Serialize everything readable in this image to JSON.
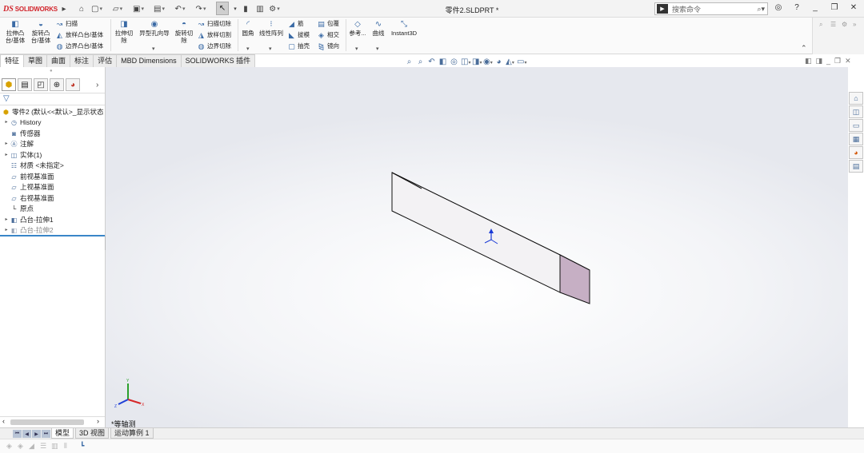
{
  "titlebar": {
    "logo_ds": "DS",
    "logo_text": "SOLIDWORKS",
    "document_title": "零件2.SLDPRT *",
    "search_placeholder": "搜索命令"
  },
  "ribbon": {
    "extrude_boss": "拉伸凸台/基体",
    "revolve_boss": "旋转凸台/基体",
    "sweep": "扫描",
    "loft_boss": "放样凸台/基体",
    "boundary_boss": "边界凸台/基体",
    "extrude_cut": "拉伸切除",
    "hole_wizard": "异型孔向导",
    "revolve_cut": "旋转切除",
    "swept_cut": "扫描切除",
    "lofted_cut": "放样切割",
    "boundary_cut": "边界切除",
    "fillet": "圆角",
    "linear_pattern": "线性阵列",
    "rib": "筋",
    "draft": "拔模",
    "shell": "抽壳",
    "wrap": "包覆",
    "intersect": "相交",
    "mirror": "镜向",
    "reference": "参考...",
    "curves": "曲线",
    "instant3d": "Instant3D"
  },
  "tabs": [
    "特征",
    "草图",
    "曲面",
    "标注",
    "评估",
    "MBD Dimensions",
    "SOLIDWORKS 插件"
  ],
  "active_tab": "特征",
  "tree": {
    "root": "零件2 (默认<<默认>_显示状态",
    "items": [
      {
        "label": "History",
        "icon": "history-icon",
        "expandable": true
      },
      {
        "label": "传感器",
        "icon": "sensor-icon",
        "expandable": false
      },
      {
        "label": "注解",
        "icon": "annotation-icon",
        "expandable": true
      },
      {
        "label": "实体(1)",
        "icon": "solid-body-icon",
        "expandable": true
      },
      {
        "label": "材质 <未指定>",
        "icon": "material-icon",
        "expandable": false
      },
      {
        "label": "前视基准面",
        "icon": "plane-icon",
        "expandable": false
      },
      {
        "label": "上视基准面",
        "icon": "plane-icon",
        "expandable": false
      },
      {
        "label": "右视基准面",
        "icon": "plane-icon",
        "expandable": false
      },
      {
        "label": "原点",
        "icon": "origin-icon",
        "expandable": false
      },
      {
        "label": "凸台-拉伸1",
        "icon": "extrude-feature-icon",
        "expandable": true
      },
      {
        "label": "凸台-拉伸2",
        "icon": "extrude-feature-icon",
        "expandable": true,
        "suppressed": true
      }
    ]
  },
  "viewport": {
    "view_label": "*等轴测",
    "model_top_color": "#ffffff",
    "model_side_color": "#f3f2f4",
    "model_end_color": "#c6afc4",
    "edge_color": "#111111"
  },
  "bottom_tabs": [
    "模型",
    "3D 视图",
    "运动算例 1"
  ],
  "active_bottom_tab": "模型"
}
